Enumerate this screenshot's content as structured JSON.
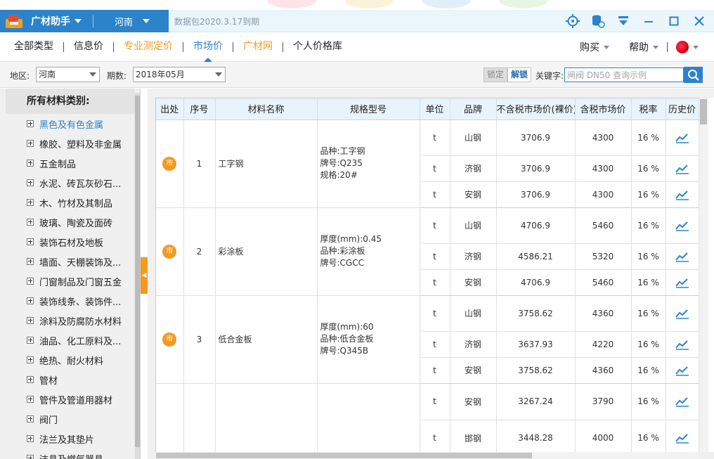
{
  "app": {
    "name": "广材助手",
    "region": "河南",
    "expire_text": "数据包2020.3.17到期"
  },
  "titlebar_icons": [
    "target-icon",
    "database-icon",
    "download-icon",
    "minimize-icon",
    "maximize-icon",
    "close-icon"
  ],
  "nav": {
    "items": [
      {
        "label": "全部类型"
      },
      {
        "label": "信息价"
      },
      {
        "label": "专业测定价"
      },
      {
        "label": "市场价"
      },
      {
        "label": "广材网"
      },
      {
        "label": "个人价格库"
      }
    ],
    "buy": "购买",
    "help": "帮助"
  },
  "filter": {
    "region_label": "地区:",
    "region_value": "河南",
    "period_label": "期数:",
    "period_value": "2018年05月",
    "lock": "锁定",
    "unlock": "解锁",
    "keyword_label": "关键字:",
    "keyword_placeholder": "闸阀 DN50 查询示例"
  },
  "sidebar": {
    "title": "所有材料类别:",
    "items": [
      {
        "label": "黑色及有色金属"
      },
      {
        "label": "橡胶、塑料及非金属"
      },
      {
        "label": "五金制品"
      },
      {
        "label": "水泥、砖瓦灰砂石..."
      },
      {
        "label": "木、竹材及其制品"
      },
      {
        "label": "玻璃、陶瓷及面砖"
      },
      {
        "label": "装饰石材及地板"
      },
      {
        "label": "墙面、天棚装饰及..."
      },
      {
        "label": "门窗制品及门窗五金"
      },
      {
        "label": "装饰线条、装饰件..."
      },
      {
        "label": "涂料及防腐防水材料"
      },
      {
        "label": "油品、化工原料及..."
      },
      {
        "label": "绝热、耐火材料"
      },
      {
        "label": "管材"
      },
      {
        "label": "管件及管道用器材"
      },
      {
        "label": "阀门"
      },
      {
        "label": "法兰及其垫片"
      },
      {
        "label": "洁具及燃气器具"
      }
    ]
  },
  "table": {
    "headers": [
      "出处",
      "序号",
      "材料名称",
      "规格型号",
      "单位",
      "品牌",
      "不含税市场价(裸价)",
      "含税市场价",
      "税率",
      "历史价"
    ],
    "source_badge": "市",
    "groups": [
      {
        "index": "1",
        "name": "工字钢",
        "spec": [
          "品种:工字钢",
          "牌号:Q235",
          "规格:20#"
        ],
        "rows": [
          {
            "unit": "t",
            "brand": "山钢",
            "price_ex": "3706.9",
            "price_in": "4300",
            "tax": "16 %"
          },
          {
            "unit": "t",
            "brand": "济钢",
            "price_ex": "3706.9",
            "price_in": "4300",
            "tax": "16 %"
          },
          {
            "unit": "t",
            "brand": "安钢",
            "price_ex": "3706.9",
            "price_in": "4300",
            "tax": "16 %"
          }
        ]
      },
      {
        "index": "2",
        "name": "彩涂板",
        "spec": [
          "厚度(mm):0.45",
          "品种:彩涂板",
          "牌号:CGCC"
        ],
        "rows": [
          {
            "unit": "t",
            "brand": "山钢",
            "price_ex": "4706.9",
            "price_in": "5460",
            "tax": "16 %"
          },
          {
            "unit": "t",
            "brand": "济钢",
            "price_ex": "4586.21",
            "price_in": "5320",
            "tax": "16 %"
          },
          {
            "unit": "t",
            "brand": "安钢",
            "price_ex": "4706.9",
            "price_in": "5460",
            "tax": "16 %"
          }
        ]
      },
      {
        "index": "3",
        "name": "低合金板",
        "spec": [
          "厚度(mm):60",
          "品种:低合金板",
          "牌号:Q345B"
        ],
        "rows": [
          {
            "unit": "t",
            "brand": "山钢",
            "price_ex": "3758.62",
            "price_in": "4360",
            "tax": "16 %"
          },
          {
            "unit": "t",
            "brand": "济钢",
            "price_ex": "3637.93",
            "price_in": "4220",
            "tax": "16 %"
          },
          {
            "unit": "t",
            "brand": "安钢",
            "price_ex": "3758.62",
            "price_in": "4360",
            "tax": "16 %"
          }
        ]
      },
      {
        "index": "",
        "name": "",
        "spec": [],
        "rows": [
          {
            "unit": "t",
            "brand": "安钢",
            "price_ex": "3267.24",
            "price_in": "3790",
            "tax": "16 %"
          },
          {
            "unit": "t",
            "brand": "邯钢",
            "price_ex": "3448.28",
            "price_in": "4000",
            "tax": "16 %"
          }
        ]
      }
    ]
  },
  "colors": {
    "brand_blue": "#2d83c9",
    "accent_orange": "#f39a1f"
  }
}
